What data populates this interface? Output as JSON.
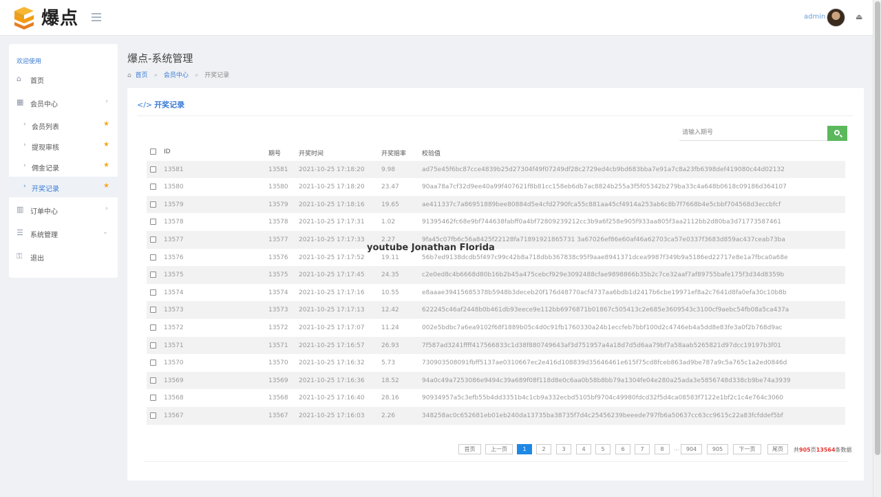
{
  "header": {
    "brand": "爆点",
    "admin_name": "admin"
  },
  "sidebar": {
    "welcome": "欢迎使用",
    "items": [
      {
        "label": "首页",
        "icon": "home-icon"
      },
      {
        "label": "会员中心",
        "icon": "grid-icon"
      },
      {
        "label": "会员列表"
      },
      {
        "label": "提现审核"
      },
      {
        "label": "佣金记录"
      },
      {
        "label": "开奖记录"
      },
      {
        "label": "订单中心",
        "icon": "bar-chart-icon"
      },
      {
        "label": "系统管理",
        "icon": "list-icon"
      },
      {
        "label": "退出",
        "icon": "key-icon"
      }
    ]
  },
  "page": {
    "title": "爆点-系统管理",
    "breadcrumb": [
      "首页",
      "会员中心",
      "开奖记录"
    ]
  },
  "panel": {
    "title": "开奖记录",
    "search_placeholder": "请输入期号"
  },
  "table": {
    "headers": [
      "ID",
      "期号",
      "开奖时间",
      "开奖赔率",
      "校验值"
    ],
    "rows": [
      [
        "13581",
        "13581",
        "2021-10-25 17:18:20",
        "9.98",
        "ad75e45f6bc87cce4839b25d27304f49f07249df28c2729ed4cb9bd683bba7e91a7c8a23fb6398def419080c44d02132"
      ],
      [
        "13580",
        "13580",
        "2021-10-25 17:18:20",
        "23.47",
        "90aa78a7cf32d9ee40a99f407621f8b81cc158eb6db7ac8824b255a3f5f05342b279ba33c4a648b0618c09186d364107"
      ],
      [
        "13579",
        "13579",
        "2021-10-25 17:18:16",
        "19.65",
        "ae411337c7a86951889bee80884d5e4cfd2790fca55c881aa45cf4914a253ab6c8b7f7668b4e5cbbf704568d3eccbfcf"
      ],
      [
        "13578",
        "13578",
        "2021-10-25 17:17:31",
        "1.02",
        "91395462fc68e9bf744638fabff0a4bf72809239212cc3b9a6f258e905f933aa805f3aa2112bb2d80ba3d71773587461"
      ],
      [
        "13577",
        "13577",
        "2021-10-25 17:17:33",
        "2.27",
        "9fa45c07fb6c56a8425f22128fa71891921865731 3a67026ef86e60af46a62703ca57e0337f3683d859ac437ceab73ba"
      ],
      [
        "13576",
        "13576",
        "2021-10-25 17:17:52",
        "19.11",
        "56b7ed9138dcdb5f497c99c42b8a718dbb367838c95f9aae8941371dcea9987f349b9a5186ed22717e8e1a7fbca0a68e"
      ],
      [
        "13575",
        "13575",
        "2021-10-25 17:17:45",
        "24.35",
        "c2e0ed8c4b6668d80b16b2b45a475cebcf929e3092488cfae9898866b35b2c7ce32aaf7af89755bafe175f3d34d8359b"
      ],
      [
        "13574",
        "13574",
        "2021-10-25 17:17:16",
        "10.55",
        "e8aaae39415685378b5948b3deceb20f176d48770acf4737aa6bdb1d2417b6cbe19971ef8a2c7641d8fa0efa30c10b8b"
      ],
      [
        "13573",
        "13573",
        "2021-10-25 17:17:13",
        "12.42",
        "622245c46af2448b0b461db93eece9e112bb6976871b01867c505413c2e685e3609543c3100cf9aebc54fb08a5ca437a"
      ],
      [
        "13572",
        "13572",
        "2021-10-25 17:17:07",
        "11.24",
        "002e5bdbc7a6ea9102f68f1889b05c4d0c91fb1760330a24b1eccfeb7bbf100d2c4746eb4a5dd8e83fe3a0f2b768d9ac"
      ],
      [
        "13571",
        "13571",
        "2021-10-25 17:16:57",
        "26.93",
        "7f587ad3241ffff417566833c1d38f880749643af3d751957a4a18d7d5d6aa79bf7a58aab5265821d97dcc19197b3f01"
      ],
      [
        "13570",
        "13570",
        "2021-10-25 17:16:32",
        "5.73",
        "730903508091fbff5137ae0310667ec2e416d108839d35646461e615f75cd8fceb863ad9be787a9c5a765c1a2ed0846d"
      ],
      [
        "13569",
        "13569",
        "2021-10-25 17:16:36",
        "18.52",
        "94a0c49a7253086e9494c39a689f08f118d8e0c6aa0b58b8bb79a1304fe04e280a25ada3e5856748d338cb9be74a3939"
      ],
      [
        "13568",
        "13568",
        "2021-10-25 17:16:40",
        "28.16",
        "90934957a5c3efb55b4dd3351b4c1cb9a332ecbd5105bf9704c49980fdcd32f5d4ca08583f7122e1bf2c1c4e764c3060"
      ],
      [
        "13567",
        "13567",
        "2021-10-25 17:16:03",
        "2.26",
        "348258ac0c652681eb01eb240da13735ba38735f7d4c25456239beeede797fb6a50637cc63cc9615c22a83fcfddef5bf"
      ]
    ]
  },
  "pagination": {
    "first": "首页",
    "prev": "上一页",
    "pages": [
      "1",
      "2",
      "3",
      "4",
      "5",
      "6",
      "7",
      "8"
    ],
    "dots": "...",
    "last_pages": [
      "904",
      "905"
    ],
    "next": "下一页",
    "last": "尾页",
    "info_prefix": "共",
    "total_pages": "905",
    "info_mid": "页",
    "total_records": "13564",
    "info_suffix": "条数据"
  },
  "watermark": "youtube Jonathan Florida"
}
